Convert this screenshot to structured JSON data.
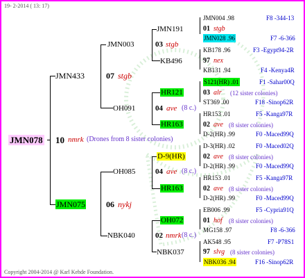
{
  "header": {
    "date": "19- 2-2014 ( 13: 17)"
  },
  "footer": {
    "copyright": "Copyright 2004-2014 @ Karl Kehde Foundation."
  },
  "root": {
    "label": "JMN078",
    "number": "10",
    "queen": "nmrk",
    "note": "(Drones from 8 sister colonies)"
  },
  "gen1": {
    "top": {
      "label": "JMN433",
      "number": "07",
      "queen": "stgb"
    },
    "bottom": {
      "label": "JMN075",
      "number": "06",
      "queen": "nykj"
    }
  },
  "gen2": {
    "a": {
      "label": "JMN003",
      "number": "03",
      "queen": "stgb"
    },
    "b": {
      "label": "OH091",
      "number": "04",
      "queen": "ave",
      "note": "(8 c.)"
    },
    "c": {
      "label": "OH085",
      "number": "04",
      "queen": "ave",
      "note": "(8 c.)"
    },
    "d": {
      "label": "NBK040",
      "number": "02",
      "queen": "nmrk",
      "note": "(8 c.)"
    }
  },
  "gen3": {
    "a1": {
      "label": "JMN191",
      "number": "01",
      "queen": "stgb"
    },
    "a2": {
      "label": "KB496",
      "number": "97",
      "queen": "nex"
    },
    "b1": {
      "label": "HR121",
      "number": "03",
      "queen": "alr",
      "note": "(12 sister colonies)"
    },
    "b2": {
      "label": "HR163",
      "number": "02",
      "queen": "ave",
      "note": "(8 sister colonies)"
    },
    "c1": {
      "label": "D-9(HR)",
      "number": "02",
      "queen": "ave",
      "note": "(8 sister colonies)"
    },
    "c2": {
      "label": "HR163",
      "number": "02",
      "queen": "ave",
      "note": "(8 sister colonies)"
    },
    "d1": {
      "label": "OH072",
      "number": "01",
      "queen": "hof",
      "note": "(8 sister colonies)"
    },
    "d2": {
      "label": "NBK037",
      "number": "97",
      "queen": "slvg",
      "note": "(8 sister colonies)"
    }
  },
  "gen4": [
    {
      "label": "JMN004 .98",
      "right": "F8 -344-13"
    },
    {
      "label": "JMN028 .96",
      "right": "F7 -6-366"
    },
    {
      "label": "KB178 .96",
      "right": "F3 -Egypt94-2R"
    },
    {
      "label": "KB131 .94",
      "right": "F4 -Kenya4R"
    },
    {
      "label": "S121(HR) .01",
      "right": "F1 -Sahar00Q"
    },
    {
      "label": "ST369 .00",
      "right": "F18 -Sinop62R"
    },
    {
      "label": "HR153 .01",
      "right": "F5 -Kanga97R"
    },
    {
      "label": "D-2(HR) .99",
      "right": "F0 -Maced99Q"
    },
    {
      "label": "D-3(HR) .02",
      "right": "F0 -Maced02Q"
    },
    {
      "label": "D-2(HR) .99",
      "right": "F0 -Maced99Q"
    },
    {
      "label": "HR153 .01",
      "right": "F5 -Kanga97R"
    },
    {
      "label": "D-2(HR) .99",
      "right": "F0 -Maced99Q"
    },
    {
      "label": "EB006 .99",
      "right": "F5 -Cypria91Q"
    },
    {
      "label": "MG158 .97",
      "right": "F8 -6-366"
    },
    {
      "label": "AK548 .95",
      "right": "F7 -P78S1"
    },
    {
      "label": "NBK036 .94",
      "right": "F16 -Sinop62R"
    }
  ],
  "colors": {
    "border": "#ff00ff",
    "highlight_green": "#00ee00",
    "highlight_cyan": "#00e5ee",
    "highlight_yellow": "#ffff00",
    "highlight_pink": "#ffccff",
    "queen_red": "#cc0000",
    "link_blue": "#0000cc"
  }
}
